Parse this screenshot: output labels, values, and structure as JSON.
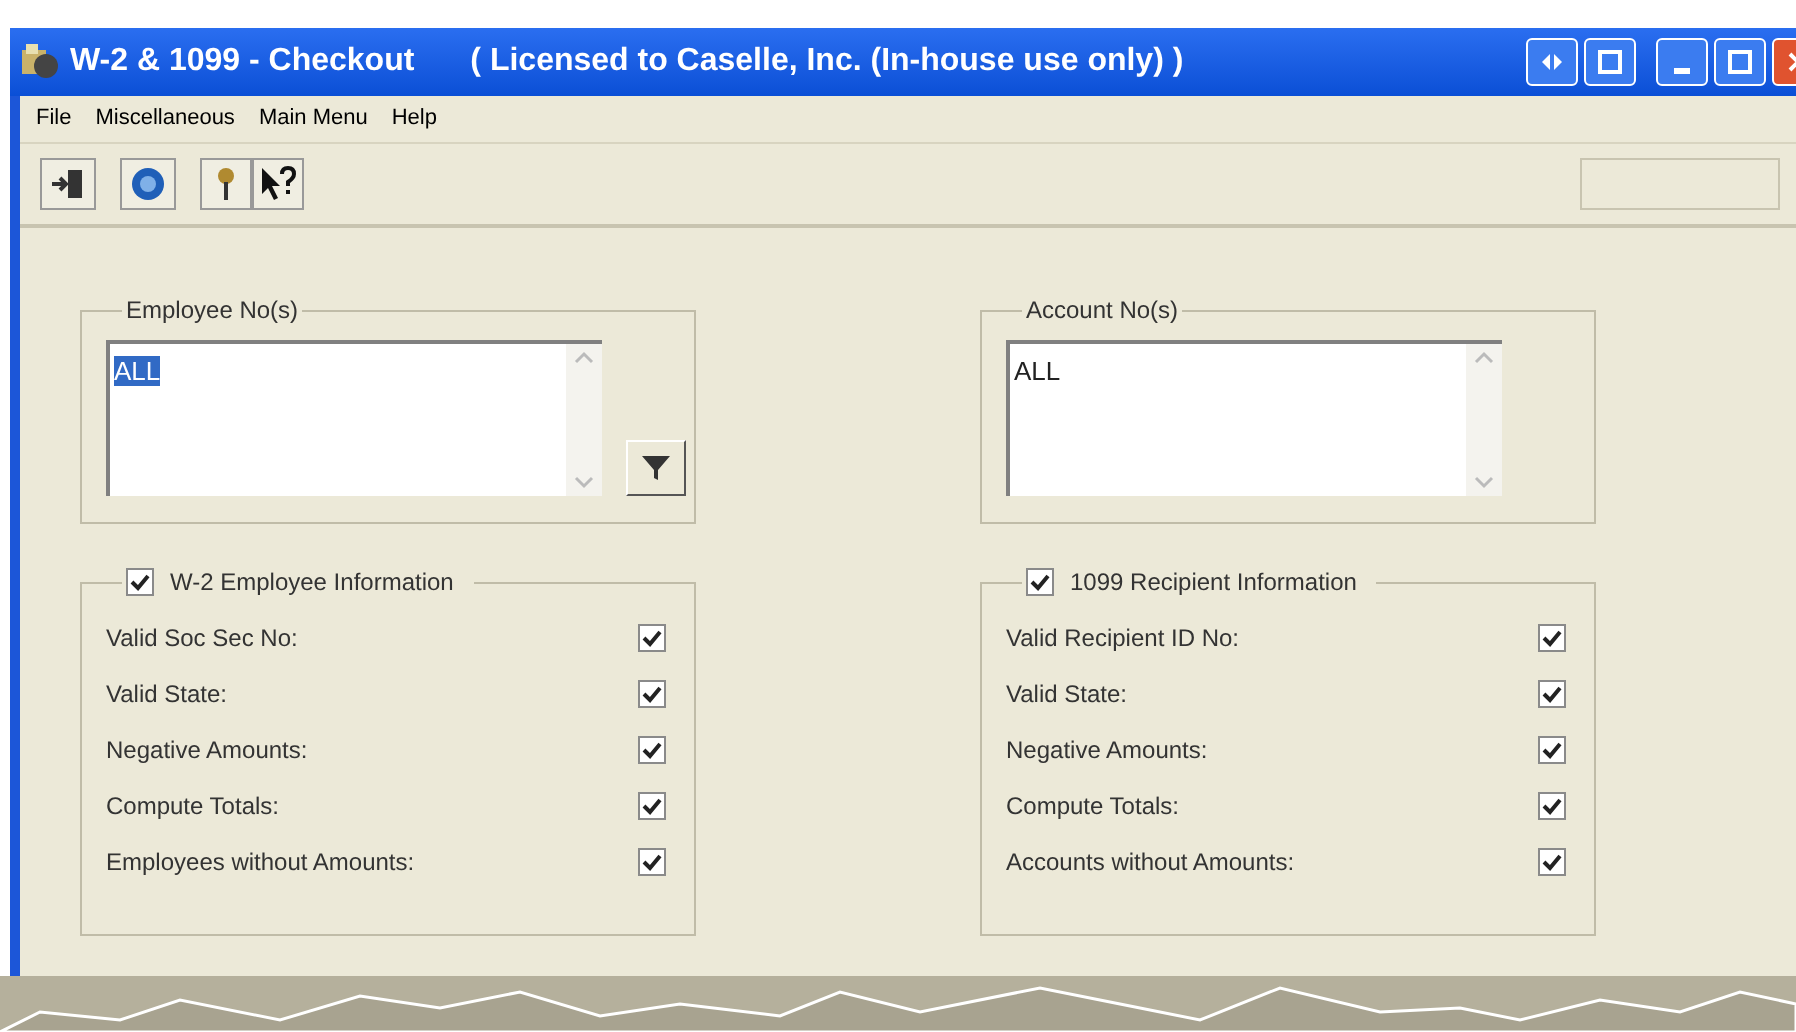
{
  "window": {
    "title": "W-2 & 1099 - Checkout",
    "license": "( Licensed to Caselle, Inc. (In-house use only) )"
  },
  "menu": [
    "File",
    "Miscellaneous",
    "Main Menu",
    "Help"
  ],
  "number_groups": [
    {
      "label": "Employee No(s)",
      "value": "ALL",
      "selected": true,
      "filter_button": true
    },
    {
      "label": "Account No(s)",
      "value": "ALL",
      "selected": false,
      "filter_button": false
    }
  ],
  "info_groups": [
    {
      "title": "W-2 Employee Information",
      "checked": true,
      "items": [
        {
          "label": "Valid Soc Sec No:",
          "checked": true
        },
        {
          "label": "Valid State:",
          "checked": true
        },
        {
          "label": "Negative Amounts:",
          "checked": true
        },
        {
          "label": "Compute Totals:",
          "checked": true
        },
        {
          "label": "Employees without Amounts:",
          "checked": true
        }
      ]
    },
    {
      "title": "1099 Recipient Information",
      "checked": true,
      "items": [
        {
          "label": "Valid Recipient ID No:",
          "checked": true
        },
        {
          "label": "Valid State:",
          "checked": true
        },
        {
          "label": "Negative Amounts:",
          "checked": true
        },
        {
          "label": "Compute Totals:",
          "checked": true
        },
        {
          "label": "Accounts without Amounts:",
          "checked": true
        }
      ]
    }
  ]
}
